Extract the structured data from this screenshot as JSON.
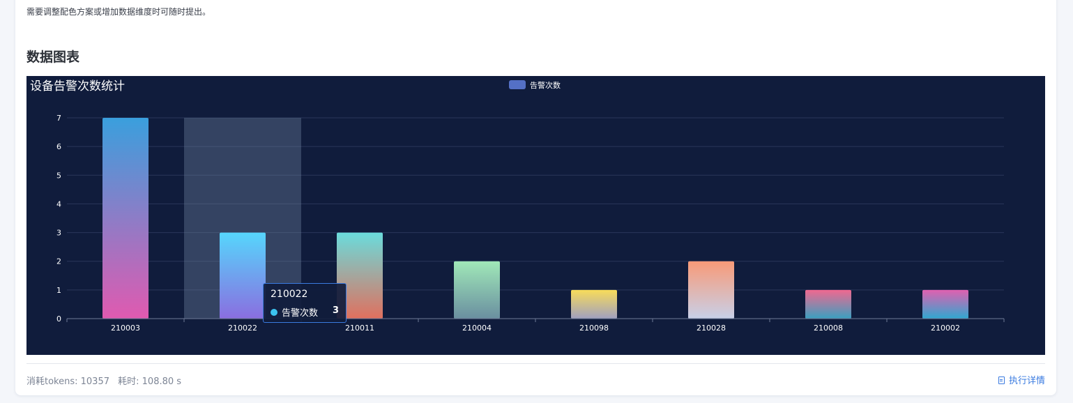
{
  "intro": {
    "note": "需要调整配色方案或增加数据维度时可随时提出。"
  },
  "section": {
    "title": "数据图表"
  },
  "chart_data": {
    "type": "bar",
    "title": "设备告警次数统计",
    "categories": [
      "210003",
      "210022",
      "210011",
      "210004",
      "210098",
      "210028",
      "210008",
      "210002"
    ],
    "series": [
      {
        "name": "告警次数",
        "values": [
          7,
          3,
          3,
          2,
          1,
          2,
          1,
          1
        ]
      }
    ],
    "ylim": [
      0,
      7
    ],
    "yticks": [
      0,
      1,
      2,
      3,
      4,
      5,
      6,
      7
    ],
    "grid": true,
    "legend": "top-center",
    "highlighted_category": "210022",
    "background": "#101c3c",
    "legend_color": "#5470c6",
    "bar_gradients": [
      [
        "#3a9fdd",
        "#e05ab0"
      ],
      [
        "#56d6fc",
        "#8a6ee0"
      ],
      [
        "#6adcdc",
        "#e0705e"
      ],
      [
        "#a0e8b8",
        "#6a8fa0"
      ],
      [
        "#f8dc5a",
        "#a0a0c0"
      ],
      [
        "#f89a78",
        "#c8d0e8"
      ],
      [
        "#f06890",
        "#3aa0c0"
      ],
      [
        "#e060b0",
        "#30a8d0"
      ]
    ]
  },
  "tooltip": {
    "category": "210022",
    "series_name": "告警次数",
    "value": "3"
  },
  "footer": {
    "tokens": "消耗tokens: 10357",
    "time": "耗时: 108.80 s",
    "details_label": "执行详情"
  }
}
